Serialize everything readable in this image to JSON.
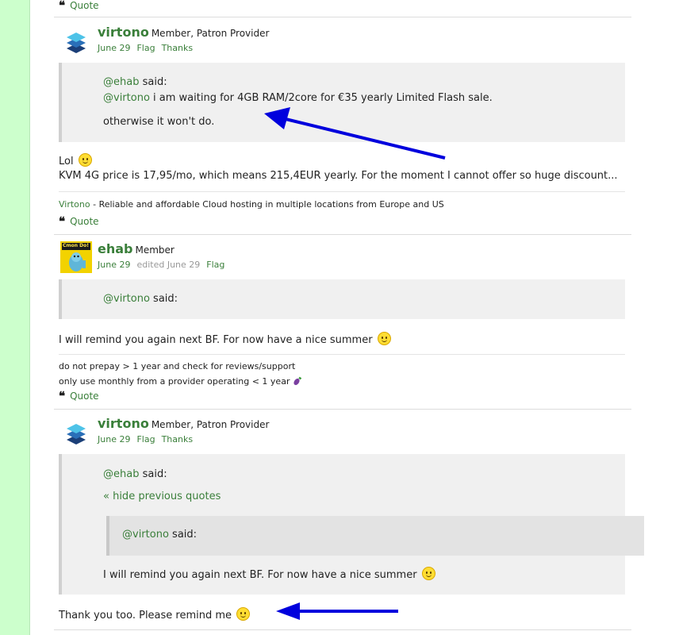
{
  "common": {
    "quote_label": "Quote",
    "flag_label": "Flag",
    "thanks_label": "Thanks",
    "said_label": "said:"
  },
  "post0": {
    "quote": "Quote"
  },
  "post1": {
    "author": "virtono",
    "role": "Member, Patron Provider",
    "date": "June 29",
    "quote_user": "@ehab",
    "quote_line_user": "@virtono",
    "quote_line_text": " i am waiting for 4GB RAM/2core for €35 yearly Limited Flash sale.",
    "quote_line2": "otherwise it won't do.",
    "body_line1": "Lol",
    "body_line2": "KVM 4G price is 17,95/mo, which means 215,4EUR yearly. For the moment I cannot offer so huge discount...",
    "sig_link": "Virtono",
    "sig_text": " - Reliable and affordable Cloud hosting in multiple locations from Europe and US"
  },
  "post2": {
    "author": "ehab",
    "role": "Member",
    "date": "June 29",
    "edited": "edited June 29",
    "avatar_text": "Cmon Do!",
    "quote_user": "@virtono",
    "body": "I will remind you again next BF. For now have a nice summer",
    "sig_line1": "do not prepay > 1 year and check for reviews/support",
    "sig_line2": "only use monthly from a provider operating < 1 year"
  },
  "post3": {
    "author": "virtono",
    "role": "Member, Patron Provider",
    "date": "June 29",
    "quote_user": "@ehab",
    "hide_quotes": "« hide previous quotes",
    "inner_quote_user": "@virtono",
    "quote_body": "I will remind you again next BF. For now have a nice summer",
    "body": "Thank you too. Please remind me"
  },
  "colors": {
    "link": "#3a7f3a",
    "side": "#ccffcc",
    "arrow": "#0000dd"
  }
}
